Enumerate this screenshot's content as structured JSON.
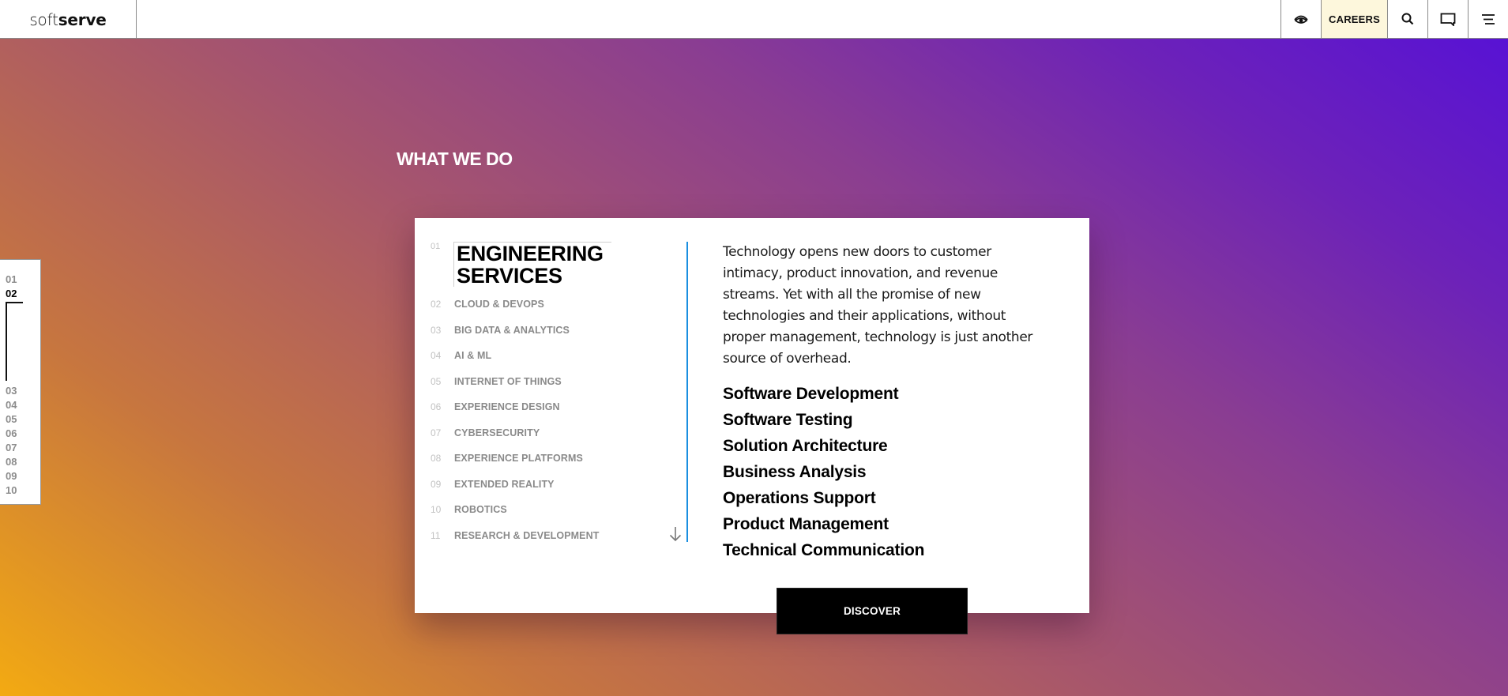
{
  "header": {
    "logo": {
      "soft": "soft",
      "serve": "serve"
    },
    "buttons": {
      "accessibility_icon": "eye-icon",
      "careers_label": "CAREERS",
      "search_icon": "search-icon",
      "contact_icon": "chat-icon",
      "menu_icon": "menu-icon"
    },
    "careers_bg": "#fdf7dc"
  },
  "pager": {
    "items": [
      "01",
      "02",
      "03",
      "04",
      "05",
      "06",
      "07",
      "08",
      "09",
      "10"
    ],
    "active": "02"
  },
  "section": {
    "title": "WHAT WE DO"
  },
  "card": {
    "nav": [
      {
        "idx": "01",
        "label": "ENGINEERING SERVICES",
        "active": true
      },
      {
        "idx": "02",
        "label": "CLOUD & DEVOPS"
      },
      {
        "idx": "03",
        "label": "BIG DATA & ANALYTICS"
      },
      {
        "idx": "04",
        "label": "AI & ML"
      },
      {
        "idx": "05",
        "label": "INTERNET OF THINGS"
      },
      {
        "idx": "06",
        "label": "EXPERIENCE DESIGN"
      },
      {
        "idx": "07",
        "label": "CYBERSECURITY"
      },
      {
        "idx": "08",
        "label": "EXPERIENCE PLATFORMS"
      },
      {
        "idx": "09",
        "label": "EXTENDED REALITY"
      },
      {
        "idx": "10",
        "label": "ROBOTICS"
      },
      {
        "idx": "11",
        "label": "RESEARCH & DEVELOPMENT"
      }
    ],
    "scroll_icon": "arrow-down-icon",
    "description": "Technology opens new doors to customer intimacy, product innovation, and revenue streams. Yet with all the promise of new technologies and their applications, without proper management, technology is just another source of overhead.",
    "services": [
      "Software Development",
      "Software Testing",
      "Solution Architecture",
      "Business Analysis",
      "Operations Support",
      "Product Management",
      "Technical Communication"
    ],
    "divider_color": "#1b8fe0"
  },
  "discover": {
    "label": "DISCOVER"
  },
  "colors": {
    "gradient_start": "#f3aa12",
    "gradient_mid": "#a6556d",
    "gradient_end": "#5510d8"
  }
}
